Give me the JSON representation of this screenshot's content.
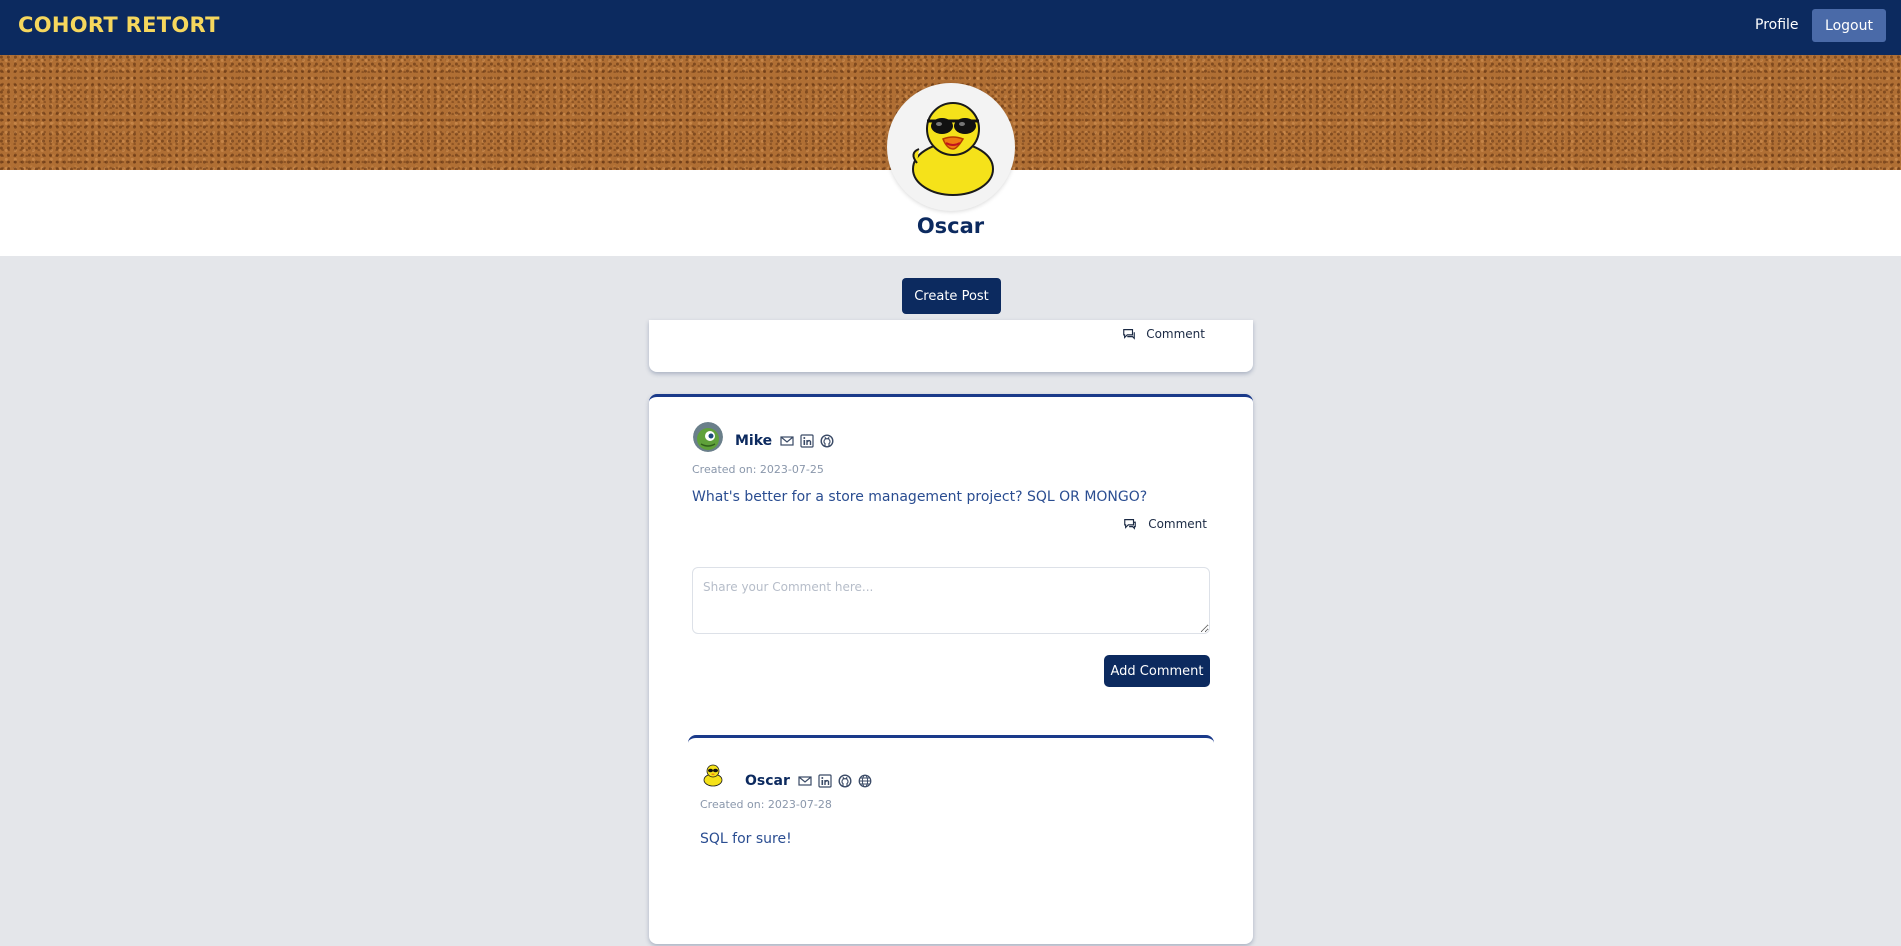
{
  "navbar": {
    "brand": "COHORT RETORT",
    "profile_link": "Profile",
    "logout_label": "Logout",
    "bg_color": "#0c2a5f",
    "brand_color": "#f6d75d"
  },
  "profile": {
    "name": "Oscar",
    "avatar_icon": "rubber-duck-sunglasses",
    "banner": "cork-texture"
  },
  "actions": {
    "create_post_label": "Create Post"
  },
  "previous_post": {
    "comment_label": "Comment"
  },
  "post": {
    "author": "Mike",
    "avatar_icon": "alien-avatar",
    "contact_icons": [
      "email-icon",
      "linkedin-icon",
      "github-icon"
    ],
    "created_label": "Created on: 2023-07-25",
    "content": "What's better for a store management project? SQL OR MONGO?",
    "comment_label": "Comment",
    "comment_placeholder": "Share your Comment here...",
    "add_comment_label": "Add Comment"
  },
  "comments": [
    {
      "author": "Oscar",
      "avatar_icon": "rubber-duck-sunglasses",
      "contact_icons": [
        "email-icon",
        "linkedin-icon",
        "github-icon",
        "globe-icon"
      ],
      "created_label": "Created on: 2023-07-28",
      "content": "SQL for sure!"
    }
  ]
}
